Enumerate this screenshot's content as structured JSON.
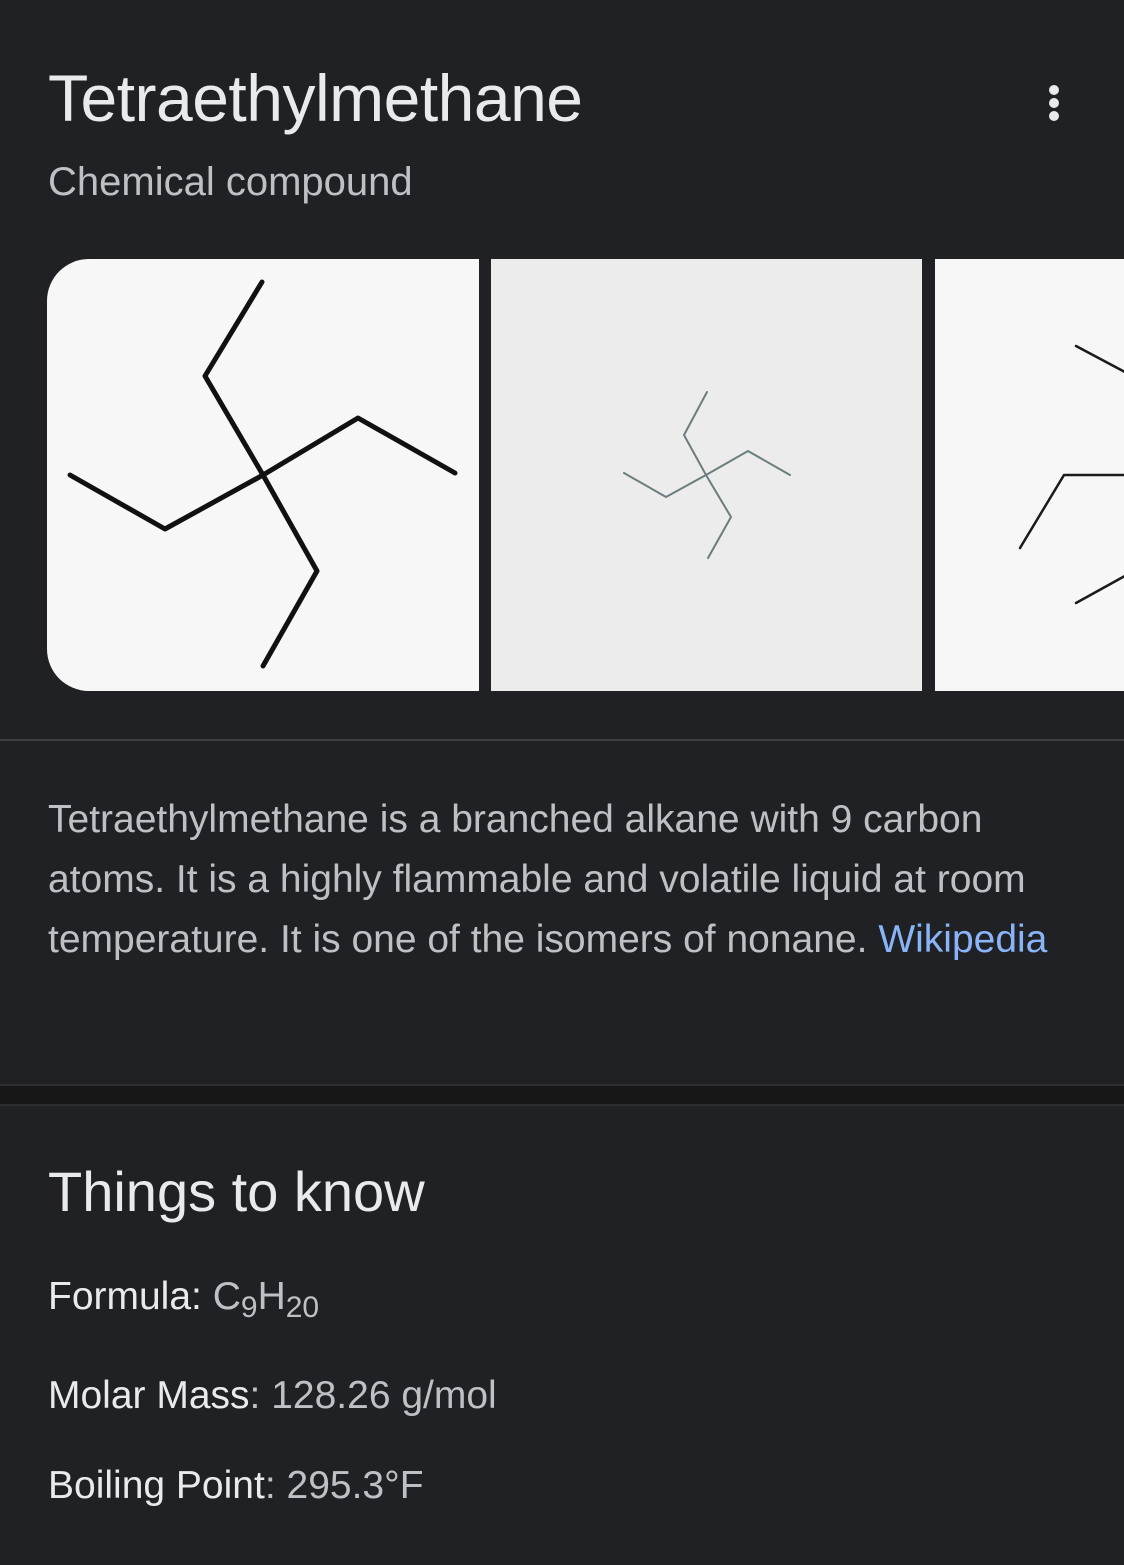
{
  "header": {
    "title": "Tetraethylmethane",
    "subtitle": "Chemical compound",
    "more_icon": "more-vert-icon"
  },
  "gallery": {
    "images": [
      {
        "depicts": "skeletal-structure-icon"
      },
      {
        "depicts": "skeletal-structure-icon"
      },
      {
        "depicts": "skeletal-structure-icon"
      }
    ]
  },
  "description": {
    "text": "Tetraethylmethane is a branched alkane with 9 carbon atoms. It is a highly flammable and volatile liquid at room temperature. It is one of the isomers of nonane.",
    "source_link": "Wikipedia"
  },
  "things_to_know": {
    "title": "Things to know",
    "facts": [
      {
        "label": "Formula:",
        "value_parts": {
          "c": "C",
          "c_sub": "9",
          "h": "H",
          "h_sub": "20"
        }
      },
      {
        "label": "Molar Mass",
        "separator": ":",
        "value": "128.26 g/mol"
      },
      {
        "label": "Boiling Point",
        "separator": ":",
        "value": "295.3°F"
      }
    ]
  },
  "colors": {
    "background": "#202124",
    "title": "#e8eaed",
    "secondary_text": "#bdc1c6",
    "link": "#8ab4f8"
  }
}
